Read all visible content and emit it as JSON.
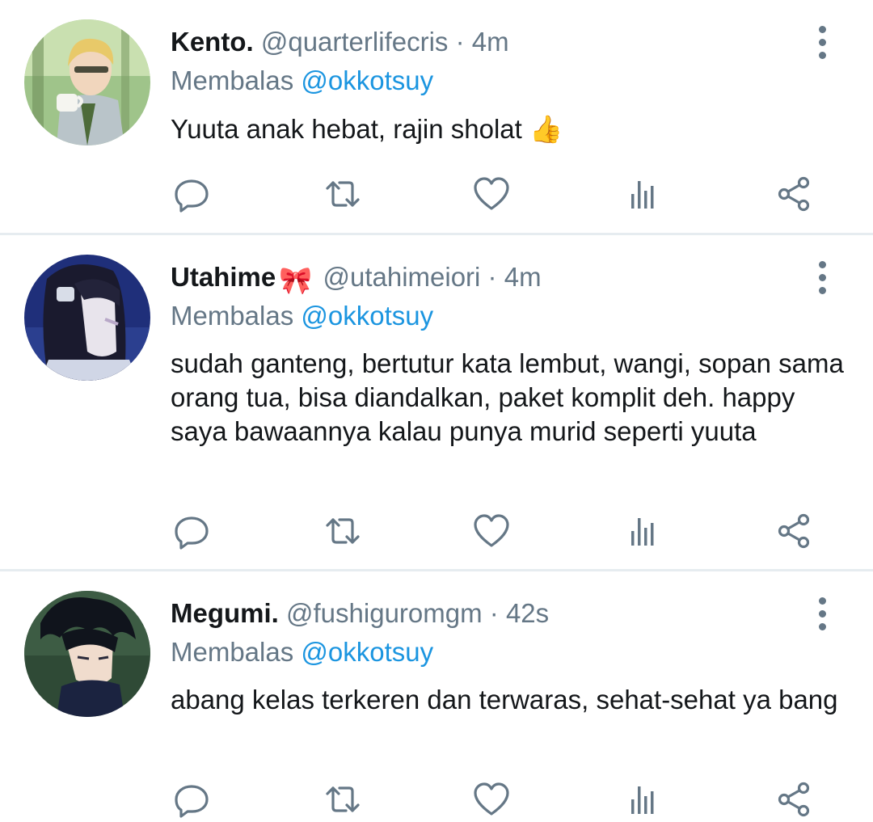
{
  "colors": {
    "text": "#14171a",
    "secondary": "#657786",
    "link": "#1b95e0",
    "separator": "#e6ecf0"
  },
  "icons": [
    "reply-icon",
    "retweet-icon",
    "like-icon",
    "analytics-icon",
    "share-icon",
    "more-icon"
  ],
  "tweets": [
    {
      "name": "Kento.",
      "handle": "@quarterlifecris",
      "dot": "·",
      "time": "4m",
      "reply_prefix": "Membalas",
      "reply_to": "@okkotsuy",
      "text": "Yuuta anak hebat, rajin sholat 👍"
    },
    {
      "name": "Utahime",
      "name_emoji": "🎀",
      "handle": "@utahimeiori",
      "dot": "·",
      "time": "4m",
      "reply_prefix": "Membalas",
      "reply_to": "@okkotsuy",
      "text": "sudah ganteng, bertutur kata lembut, wangi, sopan sama orang tua, bisa diandalkan, paket komplit deh. happy saya bawaannya kalau punya murid seperti yuuta"
    },
    {
      "name": "Megumi.",
      "handle": "@fushiguromgm",
      "dot": "·",
      "time": "42s",
      "reply_prefix": "Membalas",
      "reply_to": "@okkotsuy",
      "text": "abang kelas terkeren dan terwaras, sehat-sehat ya bang"
    }
  ]
}
